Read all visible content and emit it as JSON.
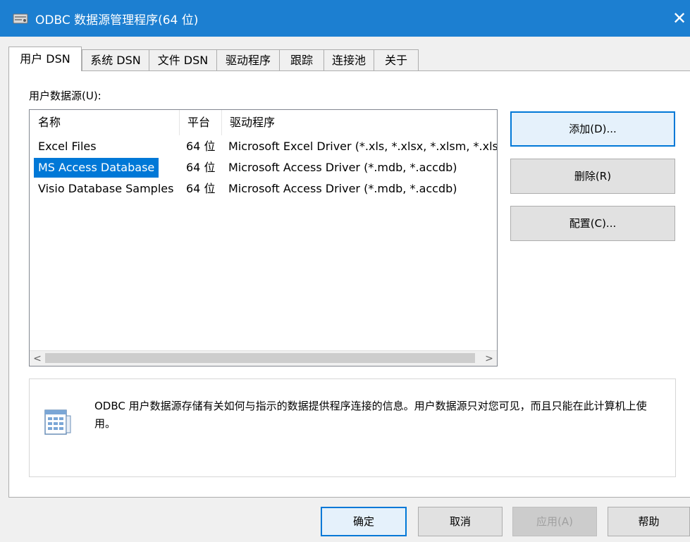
{
  "window": {
    "title": "ODBC 数据源管理程序(64 位)",
    "close_glyph": "✕"
  },
  "tabs": [
    {
      "label": "用户 DSN",
      "active": true
    },
    {
      "label": "系统 DSN"
    },
    {
      "label": "文件 DSN"
    },
    {
      "label": "驱动程序"
    },
    {
      "label": "跟踪"
    },
    {
      "label": "连接池"
    },
    {
      "label": "关于"
    }
  ],
  "data_sources": {
    "label": "用户数据源(U):",
    "columns": [
      "名称",
      "平台",
      "驱动程序"
    ],
    "rows": [
      {
        "name": "Excel Files",
        "platform": "64 位",
        "driver": "Microsoft Excel Driver (*.xls, *.xlsx, *.xlsm, *.xlsb)"
      },
      {
        "name": "MS Access Database",
        "platform": "64 位",
        "driver": "Microsoft Access Driver (*.mdb, *.accdb)",
        "selected": true
      },
      {
        "name": "Visio Database Samples",
        "platform": "64 位",
        "driver": "Microsoft Access Driver (*.mdb, *.accdb)"
      }
    ],
    "scroll_left": "<",
    "scroll_right": ">"
  },
  "side_buttons": {
    "add": "添加(D)...",
    "remove": "删除(R)",
    "configure": "配置(C)..."
  },
  "info": {
    "text": "ODBC 用户数据源存储有关如何与指示的数据提供程序连接的信息。用户数据源只对您可见，而且只能在此计算机上使用。"
  },
  "footer_buttons": {
    "ok": "确定",
    "cancel": "取消",
    "apply": "应用(A)",
    "help": "帮助"
  },
  "colors": {
    "titlebar": "#1c7fd1",
    "selection": "#0078d7"
  }
}
